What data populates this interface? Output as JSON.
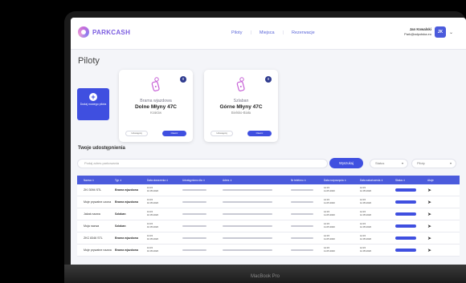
{
  "app": {
    "logo_text": "PARKCASH"
  },
  "nav": {
    "items": [
      "Piloty",
      "Miejsca",
      "Rezerwacje"
    ]
  },
  "user": {
    "name": "Jan Kowalski",
    "email": "Park@adpolska.eu",
    "initials": "JK"
  },
  "page": {
    "title": "Piloty"
  },
  "add_tile": {
    "label": "Dodaj nowego pilota"
  },
  "cards": [
    {
      "type": "Brama wjazdowa",
      "name": "Dolne Młyny 47C",
      "city": "Kraków",
      "badge": "0",
      "secondary": "Udostępnij",
      "primary": "Otwórz"
    },
    {
      "type": "Szlaban",
      "name": "Górne Młyny 47C",
      "city": "Bielsko-Biała",
      "badge": "0",
      "secondary": "Udostępnij",
      "primary": "Otwórz"
    }
  ],
  "shares": {
    "title": "Twoje udostępnienia",
    "search_placeholder": "Podaj adres parkowania",
    "search_button": "Wyszukaj",
    "status_select": "Status",
    "pilots_select": "Piloty"
  },
  "table": {
    "headers": [
      "Nazwa ⇕",
      "Typ ⇕",
      "Data utworzenia ⇕",
      "Udostępniono dla ⇕",
      "Adres ⇕",
      "Nr telefonu ⇕",
      "Data rozpoczęcia ⇕",
      "Data zakończenia ⇕",
      "Status ⇕",
      "Akcje"
    ],
    "rows": [
      {
        "name": "ZKI 3094 STL",
        "type": "Brama wjazdowa",
        "created": [
          "13:15",
          "10.05.2020"
        ],
        "start": [
          "14:15",
          "11.05.2020"
        ],
        "end": [
          "14:15",
          "12.05.2020"
        ],
        "status": "Aktywne"
      },
      {
        "name": "Moje prywatne ozona",
        "type": "Brama wjazdowa",
        "created": [
          "13:15",
          "10.05.2020"
        ],
        "start": [
          "14:15",
          "11.05.2020"
        ],
        "end": [
          "14:15",
          "12.05.2020"
        ],
        "status": "Aktywne"
      },
      {
        "name": "Jakaś nazwa",
        "type": "Szlaban",
        "created": [
          "13:15",
          "10.05.2020"
        ],
        "start": [
          "14:15",
          "11.05.2020"
        ],
        "end": [
          "14:15",
          "12.05.2020"
        ],
        "status": "Aktywne"
      },
      {
        "name": "Moja nazwa",
        "type": "Szlaban",
        "created": [
          "13:15",
          "10.05.2020"
        ],
        "start": [
          "14:15",
          "11.05.2020"
        ],
        "end": [
          "14:15",
          "12.05.2020"
        ],
        "status": "Aktywne"
      },
      {
        "name": "ZKC 8346 STL",
        "type": "Brama wjazdowa",
        "created": [
          "13:15",
          "10.05.2020"
        ],
        "start": [
          "14:15",
          "11.05.2020"
        ],
        "end": [
          "14:15",
          "12.05.2020"
        ],
        "status": "Aktywne"
      },
      {
        "name": "Moje prywatne nazwa",
        "type": "Brama wjazdowa",
        "created": [
          "13:15",
          "10.05.2020"
        ],
        "start": [
          "14:15",
          "11.05.2020"
        ],
        "end": [
          "14:15",
          "12.05.2020"
        ],
        "status": "Aktywne"
      }
    ]
  },
  "device_label": "MacBook Pro",
  "colors": {
    "accent": "#3f4fe0",
    "logo": "#7a5be0"
  }
}
